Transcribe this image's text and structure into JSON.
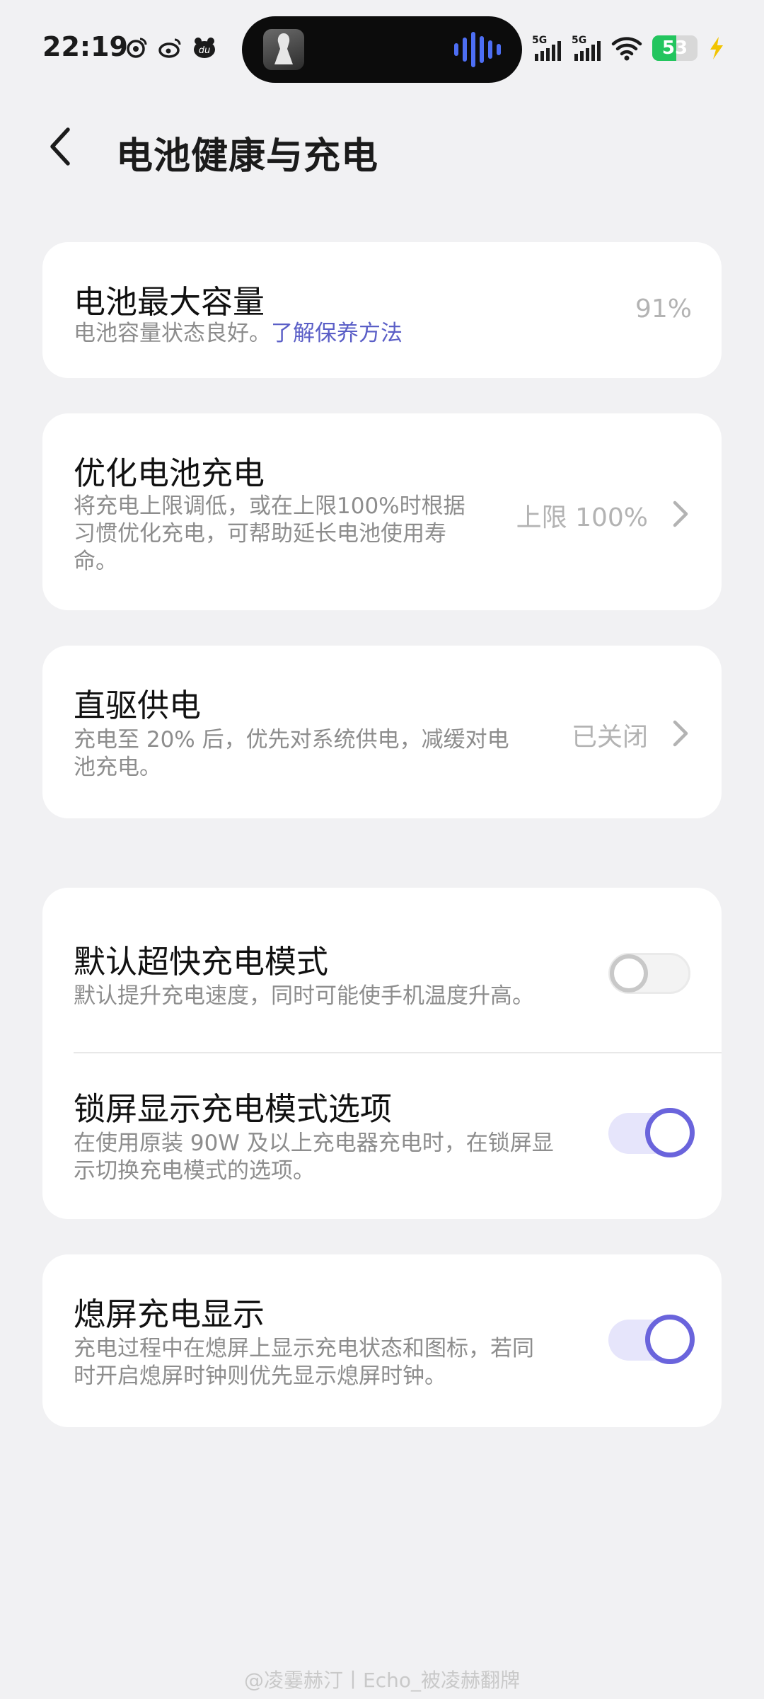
{
  "status_bar": {
    "time": "22:19",
    "network_1": "5G",
    "network_2": "5G",
    "battery_level": "53",
    "battery_fraction": 0.53,
    "icons": [
      "weibo-icon",
      "weibo-icon",
      "dewu-icon",
      "wifi-icon",
      "charging-bolt-icon"
    ]
  },
  "header": {
    "title": "电池健康与充电"
  },
  "battery_capacity": {
    "title": "电池最大容量",
    "desc_text": "电池容量状态良好。",
    "desc_link": "了解保养方法",
    "value": "91%"
  },
  "optimized_charging": {
    "title": "优化电池充电",
    "desc_line1": "将充电上限调低，或在上限100%时根据",
    "desc_line2": "习惯优化充电，可帮助延长电池使用寿",
    "desc_line3": "命。",
    "value": "上限 100%"
  },
  "direct_power": {
    "title": "直驱供电",
    "desc_line1": "充电至 20% 后，优先对系统供电，减缓对电",
    "desc_line2": "池充电。",
    "value": "已关闭"
  },
  "super_fast": {
    "title": "默认超快充电模式",
    "desc_line1": "默认提升充电速度，同时可能使手机温度升高。",
    "enabled": false
  },
  "lockscreen_options": {
    "title": "锁屏显示充电模式选项",
    "desc_line1": "在使用原装 90W 及以上充电器充电时，在锁屏显",
    "desc_line2": "示切换充电模式的选项。",
    "enabled": true
  },
  "aod_charging": {
    "title": "熄屏充电显示",
    "desc_line1": "充电过程中在熄屏上显示充电状态和图标，若同",
    "desc_line2": "时开启熄屏时钟则优先显示熄屏时钟。",
    "enabled": true
  },
  "watermark": "@凌霎赫汀丨Echo_被凌赫翻牌",
  "colors": {
    "accent": "#6a64dc",
    "link": "#5b5fc7",
    "battery_green": "#23c55e",
    "background": "#f1f1f3"
  }
}
